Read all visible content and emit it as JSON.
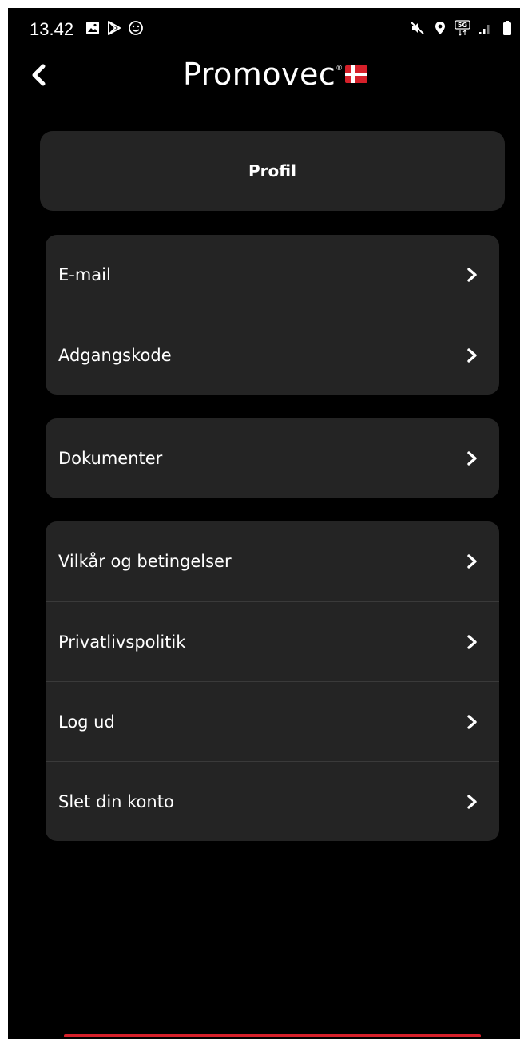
{
  "status_bar": {
    "time": "13.42",
    "network_label": "5G",
    "left_icons": [
      "gallery-icon",
      "play-store-icon",
      "smiley-icon"
    ],
    "right_icons": [
      "mute-icon",
      "location-icon",
      "network-5g-icon",
      "signal-icon",
      "battery-icon"
    ]
  },
  "header": {
    "logo_text": "Promovec",
    "logo_mark": "®",
    "flag": "denmark-flag-icon"
  },
  "page": {
    "title": "Profil"
  },
  "groups": [
    {
      "items": [
        {
          "label": "E-mail"
        },
        {
          "label": "Adgangskode"
        }
      ]
    },
    {
      "items": [
        {
          "label": "Dokumenter"
        }
      ]
    },
    {
      "items": [
        {
          "label": "Vilkår og betingelser"
        },
        {
          "label": "Privatlivspolitik"
        },
        {
          "label": "Log ud"
        },
        {
          "label": "Slet din konto"
        }
      ]
    }
  ],
  "colors": {
    "background": "#000000",
    "card": "#242424",
    "divider": "#3a3a3a",
    "text": "#ffffff",
    "flag_red": "#d6202a",
    "accent": "#d6202a"
  }
}
